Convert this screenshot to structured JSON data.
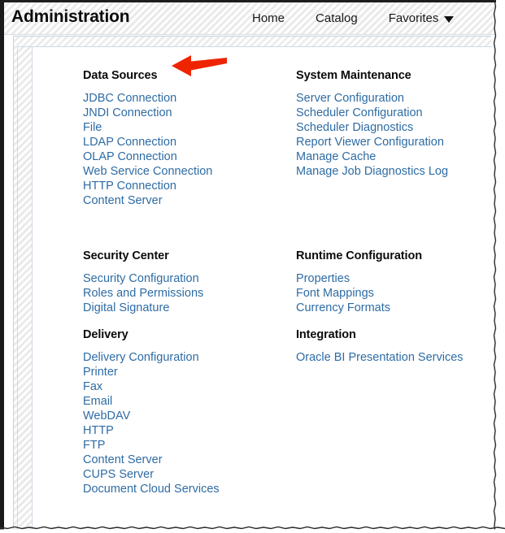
{
  "header": {
    "title": "Administration",
    "nav": [
      {
        "label": "Home",
        "type": "link"
      },
      {
        "label": "Catalog",
        "type": "link"
      },
      {
        "label": "Favorites",
        "type": "menu",
        "icon": "caret-down-icon"
      }
    ]
  },
  "annotation": {
    "type": "arrow",
    "direction": "left",
    "color": "#ee2400",
    "points_at": "Data Sources"
  },
  "colors": {
    "link": "#2e6ca4",
    "heading": "#0b0b0b",
    "arrow": "#ee2400",
    "frame_border": "#c6d2de",
    "header_bg": "#f7f7f7"
  },
  "main": {
    "columns": [
      {
        "name": "left",
        "groups": [
          {
            "title": "Data Sources",
            "links": [
              "JDBC Connection",
              "JNDI Connection",
              "File",
              "LDAP Connection",
              "OLAP Connection",
              "Web Service Connection",
              "HTTP Connection",
              "Content Server"
            ]
          },
          {
            "title": "Security Center",
            "links": [
              "Security Configuration",
              "Roles and Permissions",
              "Digital Signature"
            ]
          },
          {
            "title": "Delivery",
            "links": [
              "Delivery Configuration",
              "Printer",
              "Fax",
              "Email",
              "WebDAV",
              "HTTP",
              "FTP",
              "Content Server",
              "CUPS Server",
              "Document Cloud Services"
            ]
          }
        ]
      },
      {
        "name": "right",
        "groups": [
          {
            "title": "System Maintenance",
            "links": [
              "Server Configuration",
              "Scheduler Configuration",
              "Scheduler Diagnostics",
              "Report Viewer Configuration",
              "Manage Cache",
              "Manage Job Diagnostics Log"
            ]
          },
          {
            "title": "Runtime Configuration",
            "links": [
              "Properties",
              "Font Mappings",
              "Currency Formats"
            ]
          },
          {
            "title": "Integration",
            "links": [
              "Oracle BI Presentation Services"
            ]
          }
        ]
      }
    ]
  }
}
